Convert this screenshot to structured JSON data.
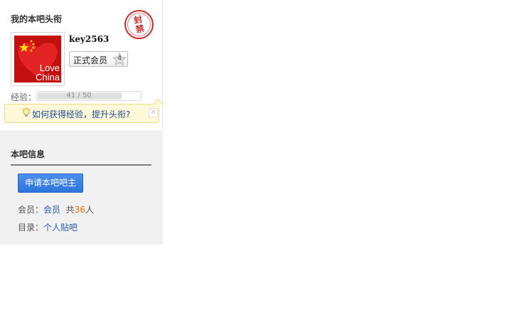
{
  "title_section": {
    "heading": "我的本吧头衔",
    "stamp_text": "封禁",
    "username": "key2563",
    "avatar": {
      "text_line1": "Love",
      "text_line2": "China"
    },
    "badge": {
      "label": "正式会员",
      "level": "4"
    },
    "experience": {
      "label": "经验：",
      "text": "41 / 50",
      "current": 41,
      "max": 50
    },
    "tip": {
      "link_text": "如何获得经验，提升头衔?",
      "close_glyph": "×"
    }
  },
  "info_section": {
    "heading": "本吧信息",
    "apply_button": "申请本吧吧主",
    "members": {
      "label": "会员：",
      "link": "会员",
      "prefix": "共",
      "count": "36",
      "suffix": "人"
    },
    "directory": {
      "label": "目录：",
      "link": "个人贴吧"
    }
  },
  "colors": {
    "accent_blue": "#2e74db",
    "link_blue": "#2a5db0",
    "stamp_red": "#c9302c",
    "count_orange": "#e07000"
  }
}
